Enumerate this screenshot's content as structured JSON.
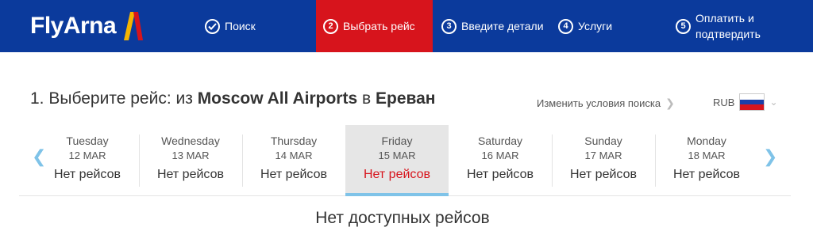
{
  "header": {
    "logo_text": "FlyArna",
    "steps": [
      {
        "label": "Поиск",
        "number": "",
        "icon": "check-circle-icon"
      },
      {
        "label": "Выбрать рейс",
        "number": "2"
      },
      {
        "label": "Введите детали",
        "number": "3"
      },
      {
        "label": "Услуги",
        "number": "4"
      },
      {
        "label_line1": "Оплатить и",
        "label_line2": "подтвердить",
        "number": "5"
      }
    ],
    "colors": {
      "background": "#0b3a9c",
      "active_step": "#d7141c"
    }
  },
  "title": {
    "prefix": "1. Выберите рейс: из ",
    "origin": "Moscow All Airports",
    "middle": " в ",
    "destination": "Ереван"
  },
  "change_search_label": "Изменить условия поиска",
  "currency": {
    "code": "RUB",
    "flag_icon": "russia-flag-icon"
  },
  "days": [
    {
      "name": "Tuesday",
      "date": "12 MAR",
      "status": "Нет рейсов"
    },
    {
      "name": "Wednesday",
      "date": "13 MAR",
      "status": "Нет рейсов"
    },
    {
      "name": "Thursday",
      "date": "14 MAR",
      "status": "Нет рейсов"
    },
    {
      "name": "Friday",
      "date": "15 MAR",
      "status": "Нет рейсов",
      "selected": true
    },
    {
      "name": "Saturday",
      "date": "16 MAR",
      "status": "Нет рейсов"
    },
    {
      "name": "Sunday",
      "date": "17 MAR",
      "status": "Нет рейсов"
    },
    {
      "name": "Monday",
      "date": "18 MAR",
      "status": "Нет рейсов"
    }
  ],
  "no_flights_message": "Нет доступных рейсов"
}
